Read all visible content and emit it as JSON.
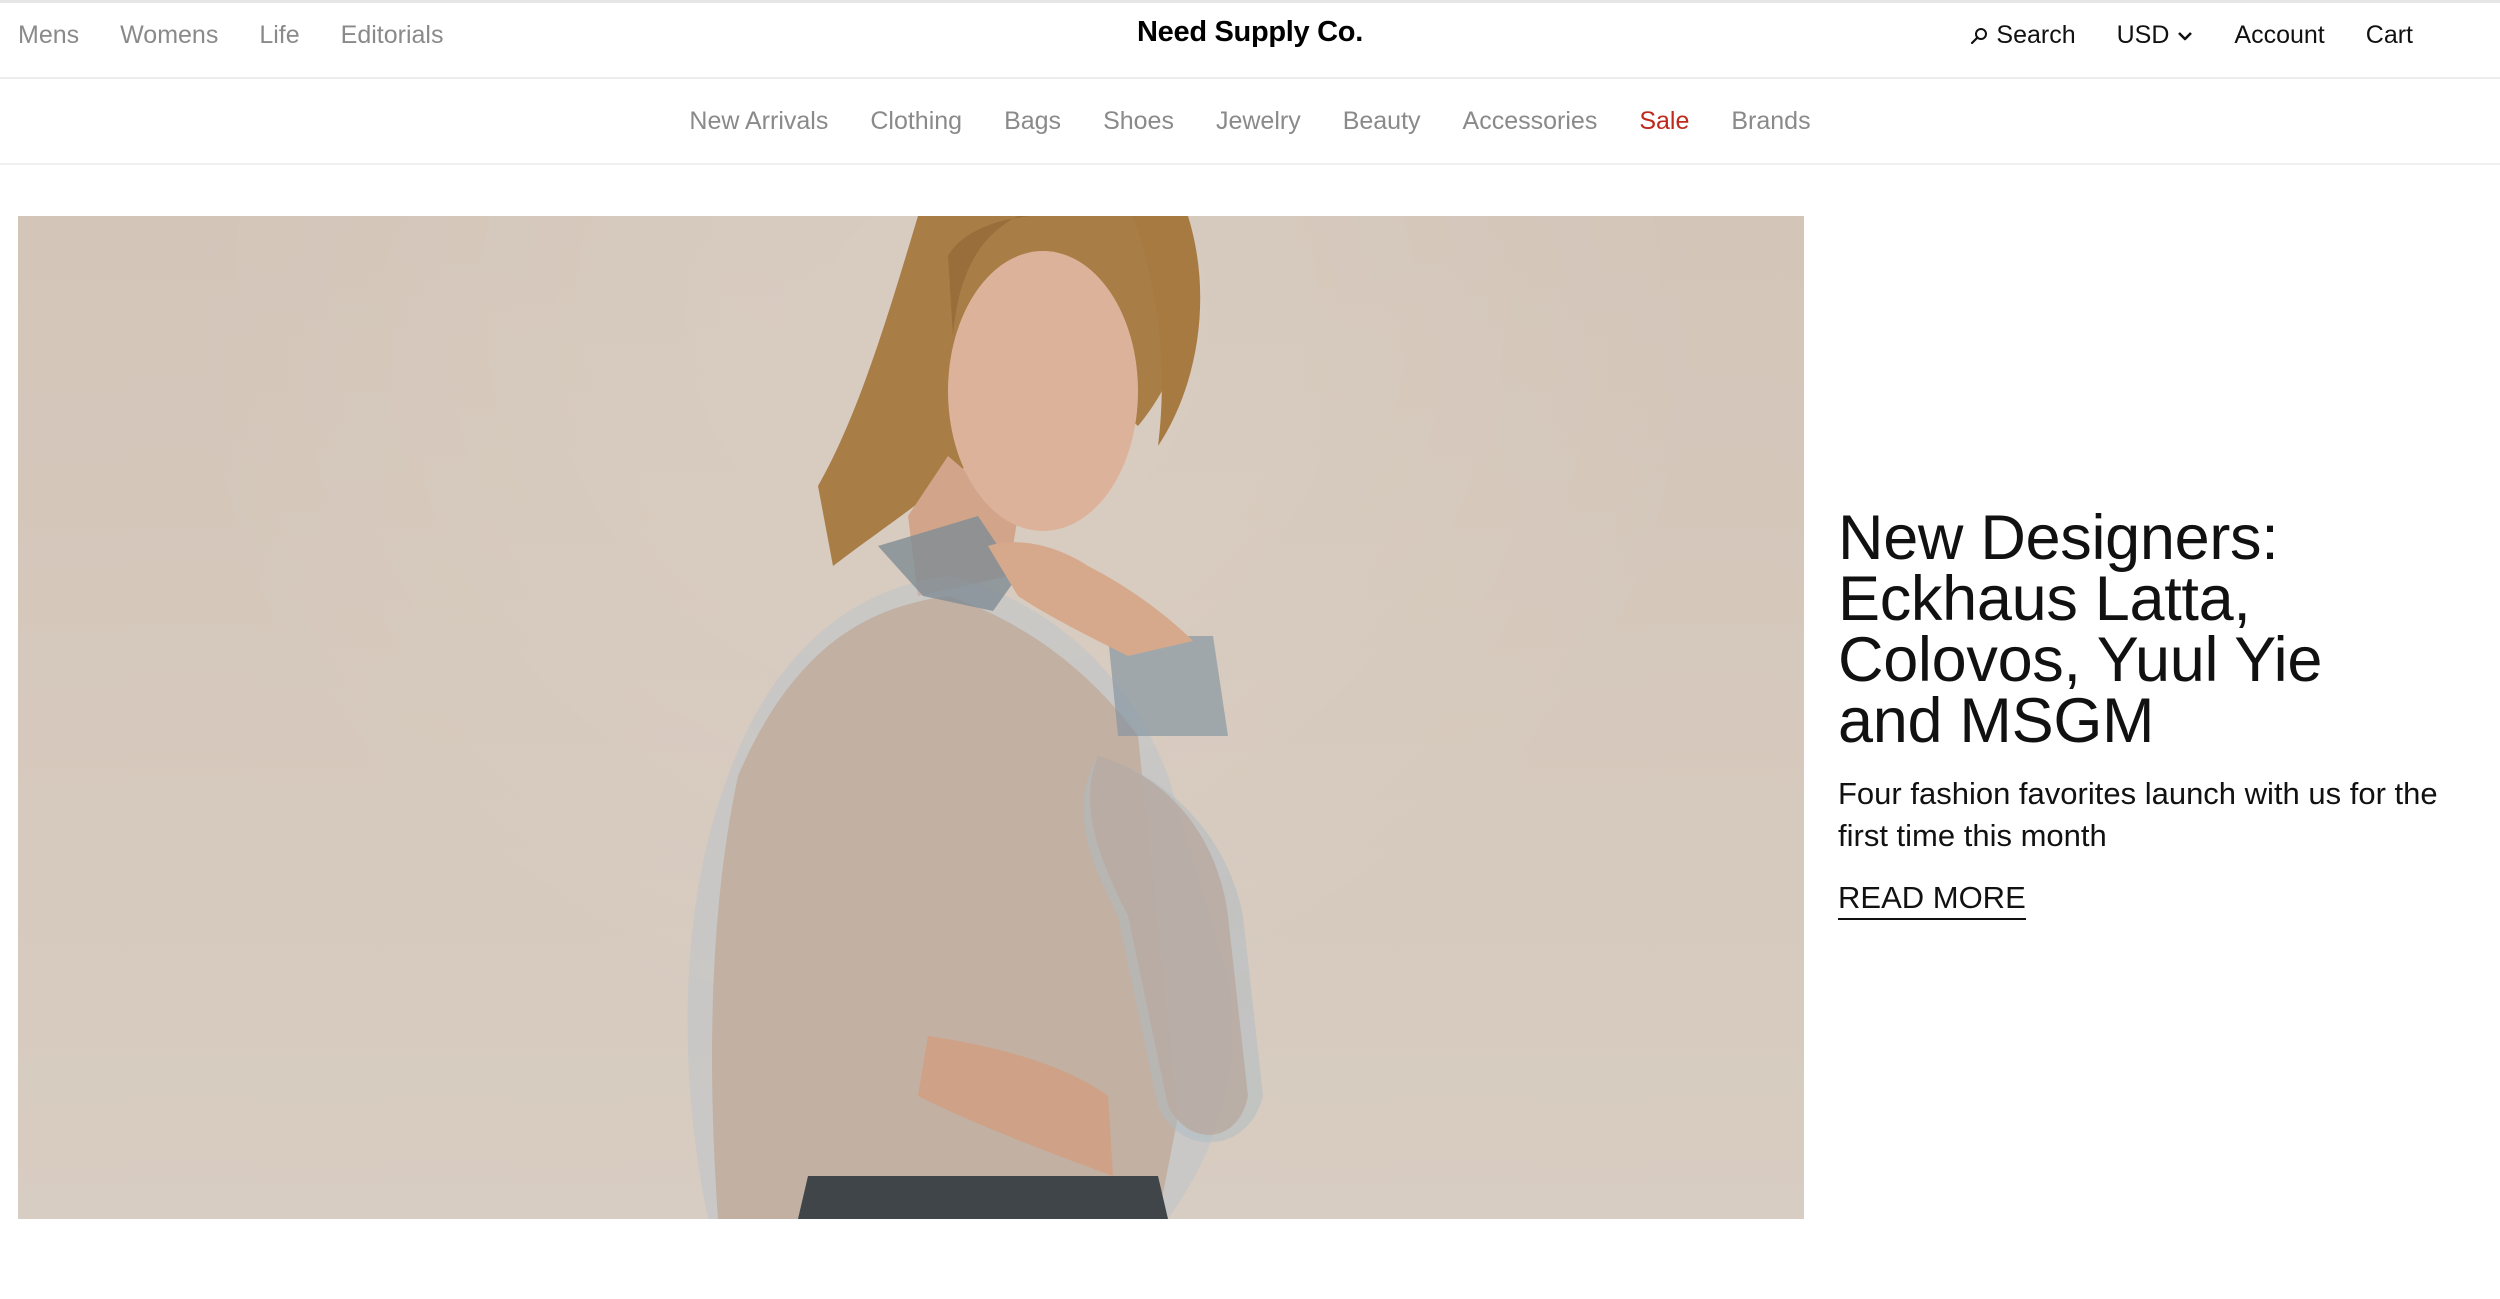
{
  "header": {
    "left_links": [
      "Mens",
      "Womens",
      "Life",
      "Editorials"
    ],
    "brand": "Need Supply Co.",
    "search_label": "Search",
    "currency_label": "USD",
    "account_label": "Account",
    "cart_label": "Cart"
  },
  "category_nav": {
    "items": [
      "New Arrivals",
      "Clothing",
      "Bags",
      "Shoes",
      "Jewelry",
      "Beauty",
      "Accessories",
      "Sale",
      "Brands"
    ]
  },
  "hero": {
    "title": "New Designers: Eckhaus Latta, Colovos, Yuul Yie and MSGM",
    "subtitle": "Four fashion favorites launch with us for the first time this month",
    "cta": "READ MORE"
  },
  "colors": {
    "sale": "#c0281b",
    "muted_text": "#8a8a8a",
    "hero_background": "#d5c8bb"
  },
  "icons": {
    "search": "search-icon",
    "currency_dropdown": "chevron-down-icon"
  }
}
